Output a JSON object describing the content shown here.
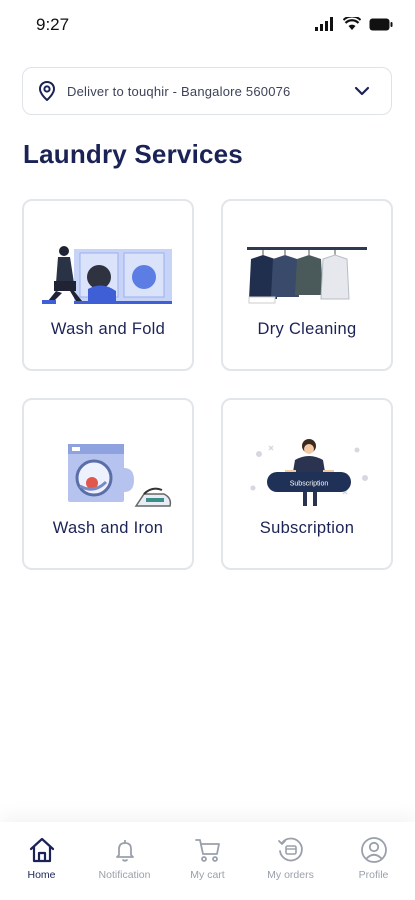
{
  "status_bar": {
    "time": "9:27"
  },
  "location": {
    "text": "Deliver to touqhir - Bangalore 560076"
  },
  "page_title": "Laundry Services",
  "services": [
    {
      "label": "Wash and Fold",
      "illustration": "washing-machine-person-illustration"
    },
    {
      "label": "Dry Cleaning",
      "illustration": "clothes-rack-illustration"
    },
    {
      "label": "Wash and Iron",
      "illustration": "washer-iron-illustration"
    },
    {
      "label": "Subscription",
      "illustration": "subscription-banner-illustration",
      "banner_text": "Subscription"
    }
  ],
  "bottom_nav": [
    {
      "label": "Home",
      "icon": "home-icon",
      "active": true
    },
    {
      "label": "Notification",
      "icon": "bell-icon",
      "active": false
    },
    {
      "label": "My cart",
      "icon": "cart-icon",
      "active": false
    },
    {
      "label": "My orders",
      "icon": "orders-icon",
      "active": false
    },
    {
      "label": "Profile",
      "icon": "profile-icon",
      "active": false
    }
  ],
  "colors": {
    "primary": "#1b2356",
    "muted": "#9aa0ab",
    "border": "#e2e5ea",
    "accent": "#3f5fd6"
  }
}
